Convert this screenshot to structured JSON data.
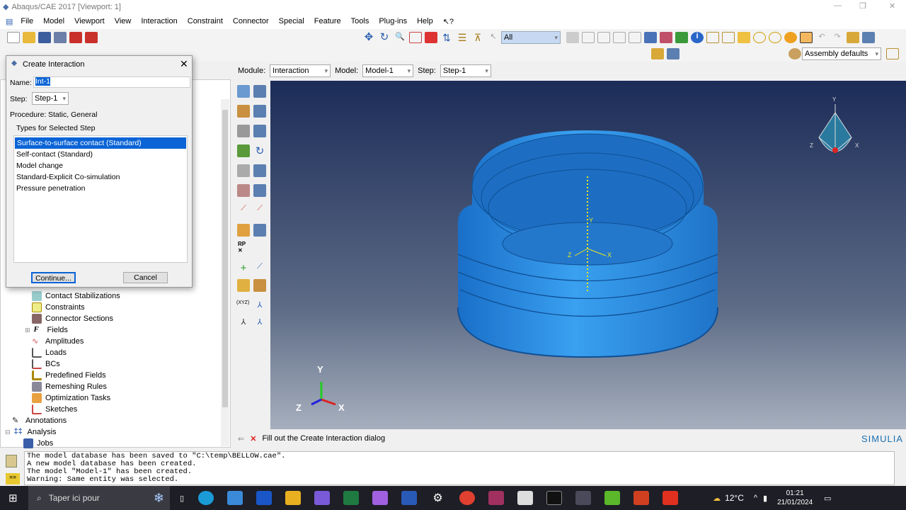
{
  "window": {
    "title": "Abaqus/CAE 2017 [Viewport: 1]"
  },
  "menu": [
    "File",
    "Model",
    "Viewport",
    "View",
    "Interaction",
    "Constraint",
    "Connector",
    "Special",
    "Feature",
    "Tools",
    "Plug-ins",
    "Help",
    "↖?"
  ],
  "toolbar": {
    "selection_filter": "All",
    "render_style": "Assembly defaults"
  },
  "context": {
    "module_label": "Module:",
    "module": "Interaction",
    "model_label": "Model:",
    "model": "Model-1",
    "step_label": "Step:",
    "step": "Step-1"
  },
  "dialog": {
    "title": "Create Interaction",
    "name_label": "Name:",
    "name_value": "Int-1",
    "step_label": "Step:",
    "step_value": "Step-1",
    "procedure_label": "Procedure:",
    "procedure_value": "Static, General",
    "group_label": "Types for Selected Step",
    "types": [
      "Surface-to-surface contact (Standard)",
      "Self-contact (Standard)",
      "Model change",
      "Standard-Explicit Co-simulation",
      "Pressure penetration"
    ],
    "selected_index": 0,
    "continue_label": "Continue...",
    "cancel_label": "Cancel"
  },
  "tree": {
    "items": [
      "Contact Stabilizations",
      "Constraints",
      "Connector Sections",
      "Fields",
      "Amplitudes",
      "Loads",
      "BCs",
      "Predefined Fields",
      "Remeshing Rules",
      "Optimization Tasks",
      "Sketches"
    ],
    "annotations": "Annotations",
    "analysis": "Analysis",
    "jobs": "Jobs"
  },
  "toolbox": {
    "rp": "RP",
    "xyz": "(XYZ)"
  },
  "viewport": {
    "triad": {
      "y": "Y",
      "z": "Z",
      "x": "X"
    },
    "csys": {
      "y": "Y",
      "z": "Z",
      "x": "X"
    },
    "brand": "SIMULIA"
  },
  "prompt": {
    "text": "Fill out the Create Interaction dialog"
  },
  "messages": [
    "The model database has been saved to \"C:\\temp\\BELLOW.cae\".",
    "A new model database has been created.",
    "The model \"Model-1\" has been created.",
    "Warning: Same entity was selected."
  ],
  "taskbar": {
    "search_placeholder": "Taper ici pour",
    "weather": "12°C",
    "time": "01:21",
    "date": "21/01/2024"
  },
  "colors": {
    "selection": "#0a64d6",
    "model": "#2a8ee0",
    "viewport_top": "#1b2c58",
    "viewport_bottom": "#a6afbd"
  }
}
